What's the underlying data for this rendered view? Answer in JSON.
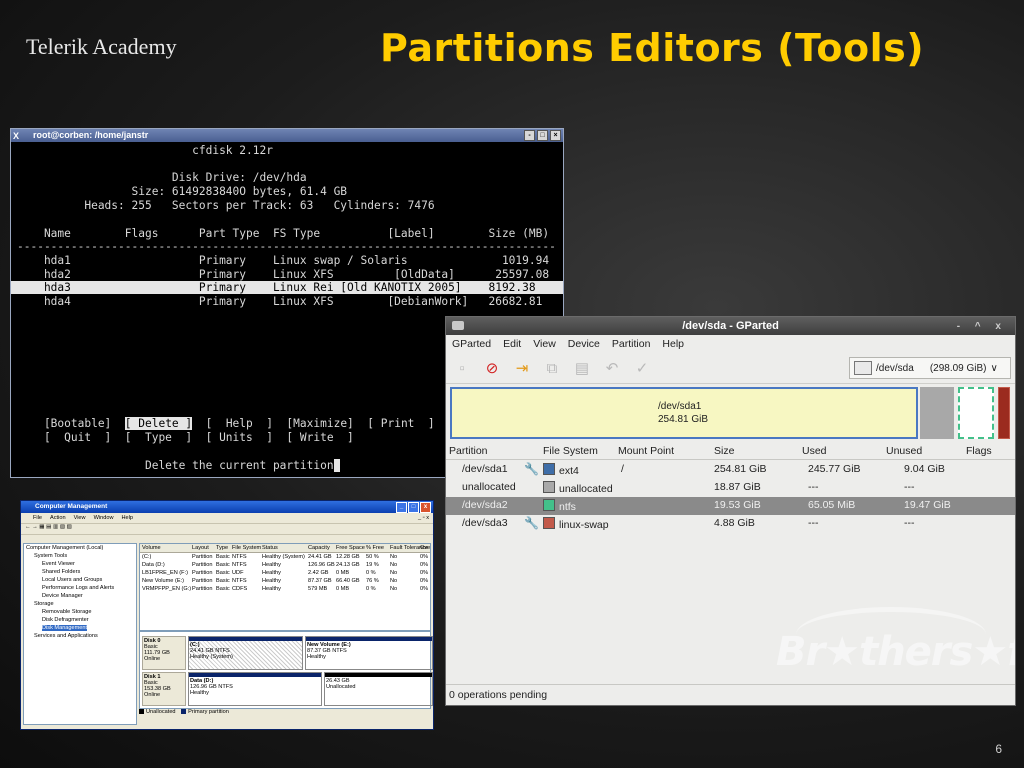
{
  "slide": {
    "logo": "Telerik Academy",
    "title": "Partitions Editors (Tools)",
    "number": "6"
  },
  "terminal": {
    "title": "root@corben: /home/janstr",
    "x_glyph": "X",
    "btns": [
      "-",
      "□",
      "×"
    ],
    "lines": [
      "                          cfdisk 2.12r",
      "",
      "                       Disk Drive: /dev/hda",
      "                 Size: 6149283840O bytes, 61.4 GB",
      "          Heads: 255   Sectors per Track: 63   Cylinders: 7476",
      "",
      "    Name        Flags      Part Type  FS Type          [Label]        Size (MB)",
      "--------------------------------------------------------------------------------",
      "    hda1                   Primary    Linux swap / Solaris              1019.94",
      "    hda2                   Primary    Linux XFS         [OldData]      25597.08"
    ],
    "selected_line": "    hda3                   Primary    Linux Rei [Old KANOTIX 2005]    8192.38",
    "last_line": "    hda4                   Primary    Linux XFS        [DebianWork]   26682.81",
    "cmd_row1_a": "    [Bootable]  ",
    "cmd_row1_sel": "[ Delete ]",
    "cmd_row1_b": "  [  Help  ]  [Maximize]  [ Print  ]",
    "cmd_row2": "    [  Quit  ]  [  Type  ]  [ Units  ]  [ Write  ]",
    "status": "                   Delete the current partition"
  },
  "gparted": {
    "title": "/dev/sda - GParted",
    "window_controls": "- ^ x",
    "menu": [
      "GParted",
      "Edit",
      "View",
      "Device",
      "Partition",
      "Help"
    ],
    "toolbar_icons": [
      "new-icon",
      "delete-icon",
      "resize-icon",
      "copy-icon",
      "paste-icon",
      "undo-icon",
      "apply-icon"
    ],
    "toolbar_glyphs": [
      "▫",
      "⊘",
      "⇥",
      "⧉",
      "▤",
      "↶",
      "✓"
    ],
    "device": "/dev/sda",
    "device_size": "(298.09 GiB)",
    "device_arrow": "∨",
    "map_label": "/dev/sda1",
    "map_size": "254.81 GiB",
    "columns": [
      "Partition",
      "File System",
      "Mount Point",
      "Size",
      "Used",
      "Unused",
      "Flags"
    ],
    "key_glyph": "🔧",
    "rows": [
      {
        "partition": "/dev/sda1",
        "key": true,
        "fs": "ext4",
        "color": "#3f6ea8",
        "mount": "/",
        "size": "254.81 GiB",
        "used": "245.77 GiB",
        "unused": "9.04 GiB",
        "flags": ""
      },
      {
        "partition": "unallocated",
        "key": false,
        "fs": "unallocated",
        "color": "#a9a9a9",
        "mount": "",
        "size": "18.87 GiB",
        "used": "---",
        "unused": "---",
        "flags": ""
      },
      {
        "partition": "/dev/sda2",
        "key": false,
        "fs": "ntfs",
        "color": "#43c08a",
        "mount": "",
        "size": "19.53 GiB",
        "used": "65.05 MiB",
        "unused": "19.47 GiB",
        "flags": ""
      },
      {
        "partition": "/dev/sda3",
        "key": true,
        "fs": "linux-swap",
        "color": "#c25a4a",
        "mount": "",
        "size": "4.88 GiB",
        "used": "---",
        "unused": "---",
        "flags": ""
      }
    ],
    "status": "0 operations pending",
    "watermark": "Br★thers★ft"
  },
  "compmgmt": {
    "title": "Computer Management",
    "controls": [
      "_",
      "□",
      "x"
    ],
    "menu": [
      "File",
      "Action",
      "View",
      "Window",
      "Help"
    ],
    "inner_controls": "_ ▫ x",
    "toolbar": "← → ▦ ▤ ▥ ▧ ▨",
    "tree": [
      {
        "label": "Computer Management (Local)",
        "indent": 0
      },
      {
        "label": "System Tools",
        "indent": 1
      },
      {
        "label": "Event Viewer",
        "indent": 2
      },
      {
        "label": "Shared Folders",
        "indent": 2
      },
      {
        "label": "Local Users and Groups",
        "indent": 2
      },
      {
        "label": "Performance Logs and Alerts",
        "indent": 2
      },
      {
        "label": "Device Manager",
        "indent": 2
      },
      {
        "label": "Storage",
        "indent": 1
      },
      {
        "label": "Removable Storage",
        "indent": 2
      },
      {
        "label": "Disk Defragmenter",
        "indent": 2
      },
      {
        "label": "Disk Management",
        "indent": 2,
        "selected": true
      },
      {
        "label": "Services and Applications",
        "indent": 1
      }
    ],
    "columns": [
      "Volume",
      "Layout",
      "Type",
      "File System",
      "Status",
      "Capacity",
      "Free Space",
      "% Free",
      "Fault Tolerance",
      "Overhe"
    ],
    "volumes": [
      [
        "(C:)",
        "Partition",
        "Basic",
        "NTFS",
        "Healthy (System)",
        "24.41 GB",
        "12.28 GB",
        "50 %",
        "No",
        "0%"
      ],
      [
        "Data (D:)",
        "Partition",
        "Basic",
        "NTFS",
        "Healthy",
        "126.96 GB",
        "24.13 GB",
        "19 %",
        "No",
        "0%"
      ],
      [
        "LB1FPRE_EN (F:)",
        "Partition",
        "Basic",
        "UDF",
        "Healthy",
        "2.42 GB",
        "0 MB",
        "0 %",
        "No",
        "0%"
      ],
      [
        "New Volume (E:)",
        "Partition",
        "Basic",
        "NTFS",
        "Healthy",
        "87.37 GB",
        "66.40 GB",
        "76 %",
        "No",
        "0%"
      ],
      [
        "VRMPFPP_EN (G:)",
        "Partition",
        "Basic",
        "CDFS",
        "Healthy",
        "579 MB",
        "0 MB",
        "0 %",
        "No",
        "0%"
      ]
    ],
    "disk0": {
      "name": "Disk 0",
      "type": "Basic",
      "size": "111.79 GB",
      "status": "Online"
    },
    "disk0_parts": [
      {
        "name": "(C:)",
        "size": "24.41 GB NTFS",
        "status": "Healthy (System)"
      },
      {
        "name": "New Volume (E:)",
        "size": "87.37 GB NTFS",
        "status": "Healthy"
      }
    ],
    "disk1": {
      "name": "Disk 1",
      "type": "Basic",
      "size": "153.38 GB",
      "status": "Online"
    },
    "disk1_parts": [
      {
        "name": "Data (D:)",
        "size": "126.96 GB NTFS",
        "status": "Healthy"
      },
      {
        "name": "",
        "size": "26.43 GB",
        "status": "Unallocated"
      }
    ],
    "legend": [
      "Unallocated",
      "Primary partition"
    ]
  }
}
